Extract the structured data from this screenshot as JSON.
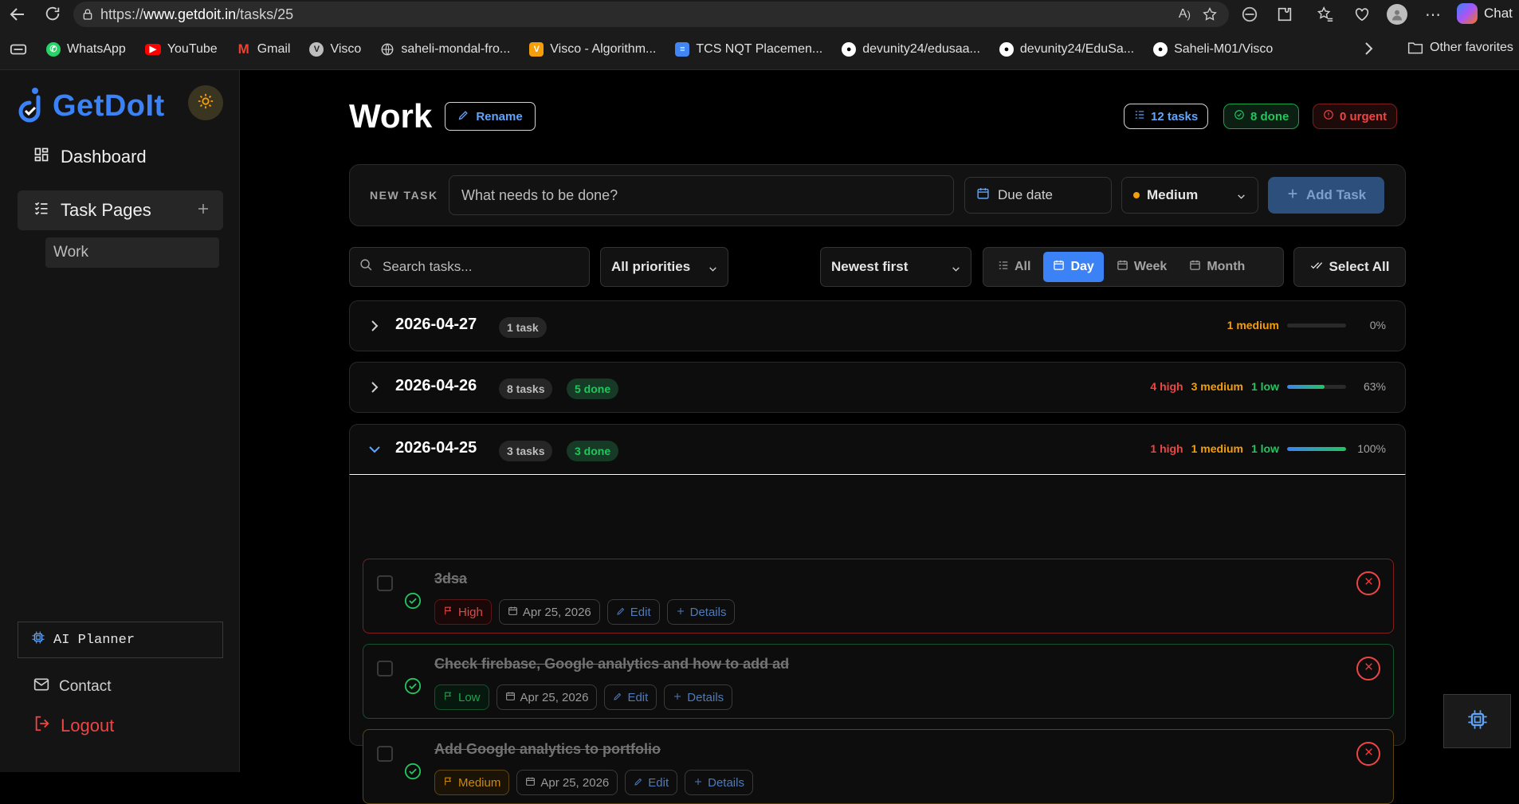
{
  "browser": {
    "url_prefix": "https://",
    "url_host": "www.getdoit.in",
    "url_path": "/tasks/25",
    "chat_label": "Chat",
    "bookmarks": [
      {
        "label": "WhatsApp",
        "icon": "whatsapp-icon",
        "color": "#25d366"
      },
      {
        "label": "YouTube",
        "icon": "youtube-icon",
        "color": "#ff0000"
      },
      {
        "label": "Gmail",
        "icon": "gmail-icon",
        "color": "#ea4335"
      },
      {
        "label": "Visco",
        "icon": "visco-icon",
        "color": "#bdbdbd"
      },
      {
        "label": "saheli-mondal-fro...",
        "icon": "globe-icon",
        "color": "#d0d0d0"
      },
      {
        "label": "Visco - Algorithm...",
        "icon": "visco-algorithm-icon",
        "color": "#f59e0b"
      },
      {
        "label": "TCS NQT Placemen...",
        "icon": "docs-icon",
        "color": "#4285f4"
      },
      {
        "label": "devunity24/edusaa...",
        "icon": "github-icon",
        "color": "#ffffff"
      },
      {
        "label": "devunity24/EduSa...",
        "icon": "github-icon",
        "color": "#ffffff"
      },
      {
        "label": "Saheli-M01/Visco",
        "icon": "github-icon",
        "color": "#ffffff"
      }
    ],
    "other_favorites": "Other favorites"
  },
  "sidebar": {
    "logo": "GetDoIt",
    "nav": {
      "dashboard": "Dashboard",
      "task_pages": "Task Pages",
      "work": "Work"
    },
    "ai_planner": "AI Planner",
    "contact": "Contact",
    "logout": "Logout"
  },
  "header": {
    "title": "Work",
    "rename": "Rename",
    "pills": {
      "tasks": "12 tasks",
      "done": "8 done",
      "urgent": "0 urgent"
    }
  },
  "new_task": {
    "label": "NEW TASK",
    "placeholder": "What needs to be done?",
    "due_date": "Due date",
    "priority": "Medium",
    "add": "Add Task"
  },
  "filters": {
    "search_placeholder": "Search tasks...",
    "priority": "All priorities",
    "sort": "Newest first",
    "views": {
      "all": "All",
      "day": "Day",
      "week": "Week",
      "month": "Month"
    },
    "select_all": "Select All"
  },
  "groups": [
    {
      "date": "2026-04-27",
      "count": "1 task",
      "medium": "1 medium",
      "progress": 0,
      "pct": "0%"
    },
    {
      "date": "2026-04-26",
      "count": "8 tasks",
      "done": "5 done",
      "high": "4 high",
      "medium": "3 medium",
      "low": "1 low",
      "progress": 63,
      "pct": "63%"
    },
    {
      "date": "2026-04-25",
      "count": "3 tasks",
      "done": "3 done",
      "high": "1 high",
      "medium": "1 medium",
      "low": "1 low",
      "progress": 100,
      "pct": "100%"
    }
  ],
  "tasks": [
    {
      "title": "3dsa",
      "priority": "High",
      "date": "Apr 25, 2026",
      "edit": "Edit",
      "details": "Details"
    },
    {
      "title": "Check firebase, Google analytics and how to add ad",
      "priority": "Low",
      "date": "Apr 25, 2026",
      "edit": "Edit",
      "details": "Details"
    },
    {
      "title": "Add Google analytics to portfolio",
      "priority": "Medium",
      "date": "Apr 25, 2026",
      "edit": "Edit",
      "details": "Details"
    }
  ],
  "colors": {
    "accent": "#3b82f6",
    "high": "#ef4444",
    "medium": "#f59e0b",
    "low": "#22c55e"
  }
}
